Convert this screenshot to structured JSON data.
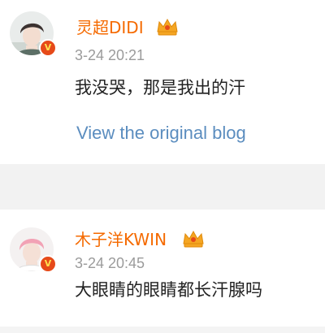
{
  "posts": [
    {
      "username": "灵超DIDI",
      "timestamp": "3-24 20:21",
      "content": "我没哭，那是我出的汗",
      "link_label": "View the original blog"
    },
    {
      "username": "木子洋KWIN",
      "timestamp": "3-24 20:45",
      "content": "大眼睛的眼睛都长汗腺吗"
    }
  ],
  "colors": {
    "username": "#f56a00",
    "timestamp": "#9b9b9b",
    "content": "#222222",
    "link": "#5b8dbf",
    "separator": "#f2f2f2",
    "verified_badge": "#e64a19",
    "crown": "#f5a623"
  },
  "icons": {
    "verified": "verified-v-badge",
    "vip": "vip-crown"
  }
}
